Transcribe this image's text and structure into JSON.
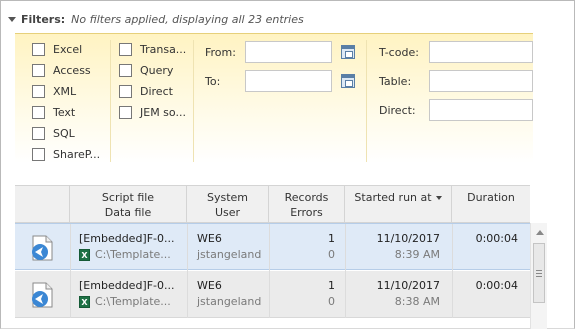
{
  "filters": {
    "label": "Filters:",
    "status": "No filters applied, displaying all 23 entries",
    "checkboxes_col1": [
      "Excel",
      "Access",
      "XML",
      "Text",
      "SQL",
      "ShareP..."
    ],
    "checkboxes_col2": [
      "Transa...",
      "Query",
      "Direct",
      "JEM so..."
    ],
    "from_label": "From:",
    "to_label": "To:",
    "from_value": "",
    "to_value": "",
    "tcode_label": "T-code:",
    "table_label": "Table:",
    "direct_label": "Direct:",
    "tcode_value": "",
    "table_value": "",
    "direct_value": ""
  },
  "table": {
    "headers": {
      "script_line1": "Script file",
      "script_line2": "Data file",
      "system_line1": "System",
      "system_line2": "User",
      "records_line1": "Records",
      "records_line2": "Errors",
      "started": "Started run at",
      "duration": "Duration"
    },
    "rows": [
      {
        "script": "[Embedded]F-0...",
        "data_file": "C:\\Template...",
        "system": "WE6",
        "user": "jstangeland",
        "records": "1",
        "errors": "0",
        "date": "11/10/2017",
        "time": "8:39 AM",
        "duration": "0:00:04"
      },
      {
        "script": "[Embedded]F-0...",
        "data_file": "C:\\Template...",
        "system": "WE6",
        "user": "jstangeland",
        "records": "1",
        "errors": "0",
        "date": "11/10/2017",
        "time": "8:38 AM",
        "duration": "0:00:04"
      }
    ]
  },
  "icons": {
    "collapse": "chevron-down-icon",
    "calendar": "calendar-icon",
    "script": "script-file-icon",
    "excel": "excel-file-icon",
    "sort": "sort-descending-icon"
  },
  "colors": {
    "filter_panel_top": "#fff3c2",
    "selected_row": "#dfeaf7",
    "alt_row": "#ebebeb",
    "excel_green": "#1e7145"
  }
}
